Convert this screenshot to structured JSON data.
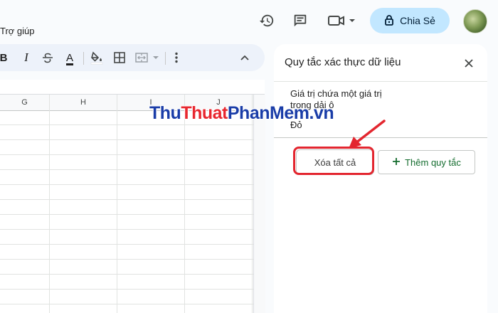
{
  "menu": {
    "help": "Trợ giúp"
  },
  "header": {
    "share_label": "Chia Sẻ",
    "icons": [
      "history-icon",
      "comment-icon",
      "video-call-icon",
      "lock-icon"
    ]
  },
  "toolbar": {
    "items": [
      "bold-icon",
      "italic-icon",
      "strikethrough-icon",
      "text-color-icon",
      "fill-color-icon",
      "borders-icon",
      "merge-cells-icon",
      "more-icon",
      "collapse-icon"
    ],
    "bold": "B",
    "italic": "I",
    "text_color": "A"
  },
  "sheet": {
    "columns": [
      "G",
      "H",
      "I",
      "J"
    ]
  },
  "panel": {
    "title": "Quy tắc xác thực dữ liệu",
    "rule": {
      "title": "Giá trị chứa một giá trị trong dải ô",
      "value": "Đỏ"
    },
    "clear_all_label": "Xóa tất cả",
    "add_rule_label": "Thêm quy tắc"
  },
  "watermark": {
    "part1": "Thu",
    "part2": "Thuat",
    "part3": "PhanMem",
    "part4": ".vn"
  },
  "colors": {
    "accent_share": "#c2e7ff",
    "highlight": "#e3262f",
    "add_rule_text": "#146c2e"
  }
}
